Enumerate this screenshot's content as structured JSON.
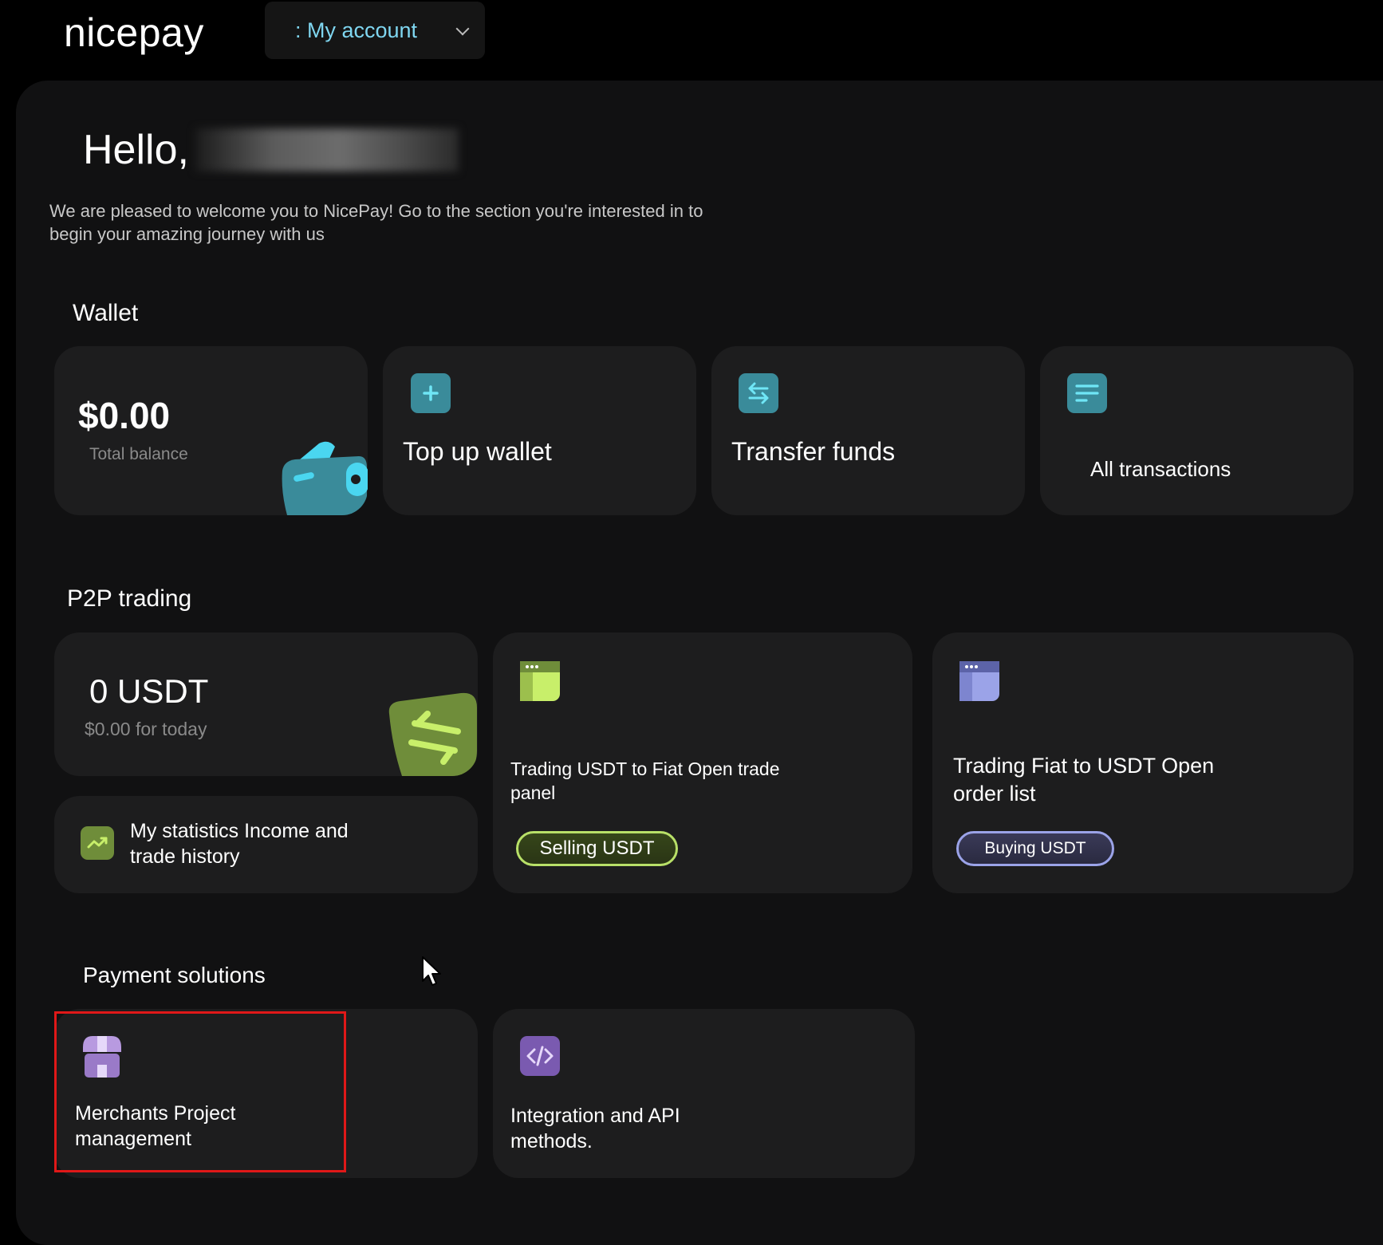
{
  "header": {
    "logo": "nicepay",
    "account_select": ": My account"
  },
  "greeting": {
    "hello": "Hello,",
    "welcome": "We are pleased to welcome you to NicePay! Go to the section you're interested in to begin your amazing journey with us"
  },
  "wallet": {
    "title": "Wallet",
    "balance": "$0.00",
    "balance_label": "Total balance",
    "top_up_label": "Top up wallet",
    "transfer_label": "Transfer funds",
    "transactions_label": "All transactions"
  },
  "p2p": {
    "title": "P2P trading",
    "usdt_value": "0 USDT",
    "usdt_today": "$0.00 for today",
    "stats_label": "My statistics Income and trade history",
    "selling_desc": "Trading USDT to Fiat Open trade panel",
    "selling_button": "Selling USDT",
    "buying_desc": "Trading Fiat to USDT Open order list",
    "buying_button": "Buying USDT"
  },
  "payments": {
    "title": "Payment solutions",
    "merchants_label": "Merchants Project management",
    "integration_label": "Integration and API methods."
  },
  "colors": {
    "background": "#000000",
    "panel": "#111112",
    "card": "#1d1d1e",
    "wallet_accent": "#4ad6f0",
    "p2p_green": "#b8e068",
    "p2p_purple": "#9ba3e8",
    "merchant_purple": "#9a7ac8",
    "highlight_red": "#e01818"
  },
  "icons": [
    "plus-icon",
    "transfer-arrows-icon",
    "list-icon",
    "wallet-illustration",
    "browser-window-icon",
    "trend-up-icon",
    "store-icon",
    "code-icon",
    "mouse-cursor-icon"
  ]
}
